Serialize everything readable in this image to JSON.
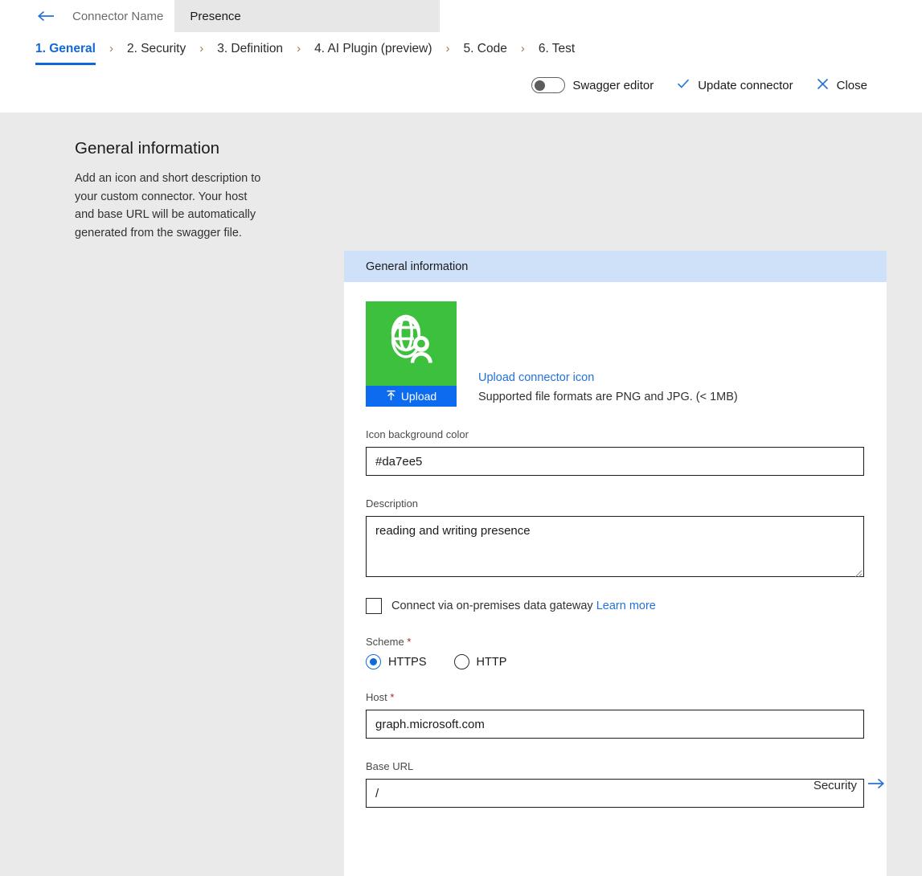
{
  "titlebar": {
    "back_icon": "arrow-left-icon",
    "connector_name_label": "Connector Name",
    "active_tab": "Presence"
  },
  "steps": [
    {
      "label": "1. General",
      "active": true
    },
    {
      "label": "2. Security",
      "active": false
    },
    {
      "label": "3. Definition",
      "active": false
    },
    {
      "label": "4. AI Plugin (preview)",
      "active": false
    },
    {
      "label": "5. Code",
      "active": false
    },
    {
      "label": "6. Test",
      "active": false
    }
  ],
  "step_separator": "›",
  "commandbar": {
    "swagger_toggle_label": "Swagger editor",
    "swagger_toggle_on": false,
    "update_label": "Update connector",
    "update_icon": "checkmark-icon",
    "close_label": "Close",
    "close_icon": "close-icon"
  },
  "left_panel": {
    "title": "General information",
    "description": "Add an icon and short description to your custom connector. Your host and base URL will be automatically generated from the swagger file."
  },
  "card": {
    "header": "General information",
    "icon": {
      "art_icon": "globe-person-icon",
      "background_color": "#3ec03f",
      "upload_button_label": "Upload",
      "upload_button_icon": "upload-icon",
      "upload_link": "Upload connector icon",
      "formats_note": "Supported file formats are PNG and JPG. (< 1MB)"
    },
    "fields": {
      "icon_background_color": {
        "label": "Icon background color",
        "value": "#da7ee5",
        "placeholder": ""
      },
      "description": {
        "label": "Description",
        "value": "reading and writing presence",
        "placeholder": ""
      },
      "gateway": {
        "label": "Connect via on-premises data gateway",
        "link": "Learn more",
        "checked": false
      },
      "scheme": {
        "label": "Scheme",
        "required": "*",
        "options": [
          {
            "label": "HTTPS",
            "selected": true
          },
          {
            "label": "HTTP",
            "selected": false
          }
        ]
      },
      "host": {
        "label": "Host",
        "required": "*",
        "value": "graph.microsoft.com",
        "placeholder": ""
      },
      "base_url": {
        "label": "Base URL",
        "value": "/",
        "placeholder": ""
      }
    }
  },
  "footer": {
    "next_label": "Security",
    "next_icon": "arrow-right-icon"
  },
  "colors": {
    "accent_blue": "#1068d8",
    "link_blue": "#2372d8",
    "card_header_blue": "#cfe0f9",
    "icon_green": "#3ec03f",
    "upload_blue": "#0d6bf0",
    "required_red": "#a4262c",
    "page_background": "#eaeaea"
  }
}
